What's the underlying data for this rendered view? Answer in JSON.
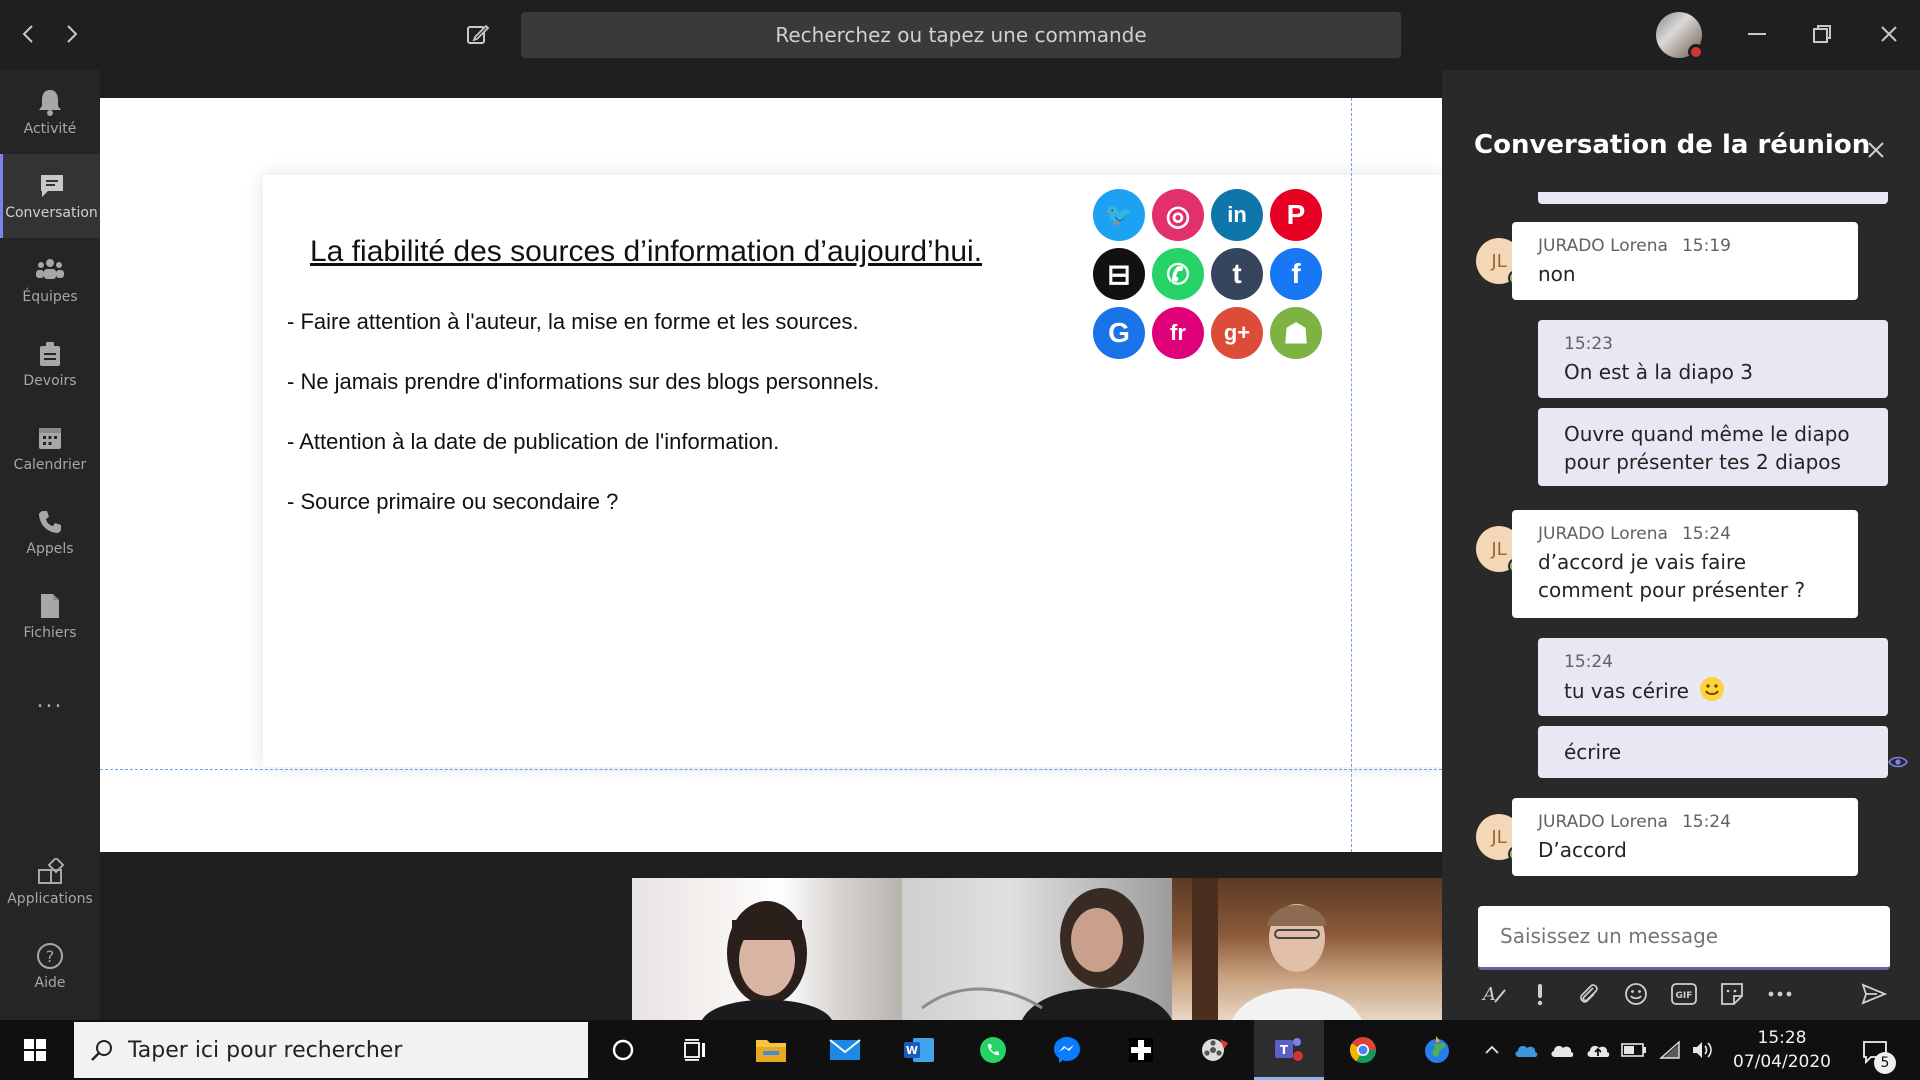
{
  "search": {
    "placeholder": "Recherchez ou tapez une commande"
  },
  "rail": {
    "items": [
      {
        "label": "Activité",
        "icon": "bell-icon"
      },
      {
        "label": "Conversation",
        "icon": "chat-icon"
      },
      {
        "label": "Équipes",
        "icon": "teams-icon"
      },
      {
        "label": "Devoirs",
        "icon": "assignments-icon"
      },
      {
        "label": "Calendrier",
        "icon": "calendar-icon"
      },
      {
        "label": "Appels",
        "icon": "phone-icon"
      },
      {
        "label": "Fichiers",
        "icon": "file-icon"
      }
    ],
    "more": "...",
    "bottom": [
      {
        "label": "Applications",
        "icon": "apps-icon"
      },
      {
        "label": "Aide",
        "icon": "help-icon"
      }
    ]
  },
  "slide": {
    "title": "La fiabilité des sources d’information d’aujourd’hui.",
    "bullets": [
      "- Faire attention à l'auteur, la mise en forme et les sources.",
      "- Ne jamais prendre d'informations sur des blogs personnels.",
      "- Attention à la date de publication de l'information.",
      "- Source primaire ou secondaire ?"
    ],
    "social_icons": [
      {
        "name": "twitter-icon",
        "color": "#1da1f2",
        "glyph": "🐦"
      },
      {
        "name": "instagram-icon",
        "color": "#e1306c",
        "glyph": "◎"
      },
      {
        "name": "linkedin-icon",
        "color": "#0e76a8",
        "glyph": "in"
      },
      {
        "name": "pinterest-icon",
        "color": "#e60023",
        "glyph": "P"
      },
      {
        "name": "uber-icon",
        "color": "#111111",
        "glyph": "⊟"
      },
      {
        "name": "whatsapp-icon",
        "color": "#25d366",
        "glyph": "✆"
      },
      {
        "name": "tumblr-icon",
        "color": "#35465c",
        "glyph": "t"
      },
      {
        "name": "facebook-icon",
        "color": "#1877f2",
        "glyph": "f"
      },
      {
        "name": "google-icon",
        "color": "#1a73e8",
        "glyph": "G"
      },
      {
        "name": "fr-icon",
        "color": "#e0007a",
        "glyph": "fr"
      },
      {
        "name": "google-plus-icon",
        "color": "#dd4b39",
        "glyph": "g+"
      },
      {
        "name": "android-icon",
        "color": "#7cb342",
        "glyph": "☗"
      }
    ]
  },
  "chat": {
    "title": "Conversation de la réunion",
    "messages": [
      {
        "type": "in",
        "initials": "JL",
        "author": "JURADO Lorena",
        "time": "15:19",
        "text": "non"
      },
      {
        "type": "out",
        "time": "15:23",
        "text": "On est à la diapo 3"
      },
      {
        "type": "out",
        "time": "",
        "text": "Ouvre quand même le diapo pour présenter tes 2 diapos"
      },
      {
        "type": "in",
        "initials": "JL",
        "author": "JURADO Lorena",
        "time": "15:24",
        "text": "d’accord je vais faire comment pour présenter ?"
      },
      {
        "type": "out",
        "time": "15:24",
        "text": "tu vas cérire"
      },
      {
        "type": "out",
        "time": "",
        "text": "écrire"
      },
      {
        "type": "in",
        "initials": "JL",
        "author": "JURADO Lorena",
        "time": "15:24",
        "text": "D’accord"
      }
    ],
    "composer_placeholder": "Saisissez un message"
  },
  "taskbar": {
    "search_text": "Taper ici pour rechercher",
    "clock_time": "15:28",
    "clock_date": "07/04/2020",
    "notifications": "5"
  }
}
